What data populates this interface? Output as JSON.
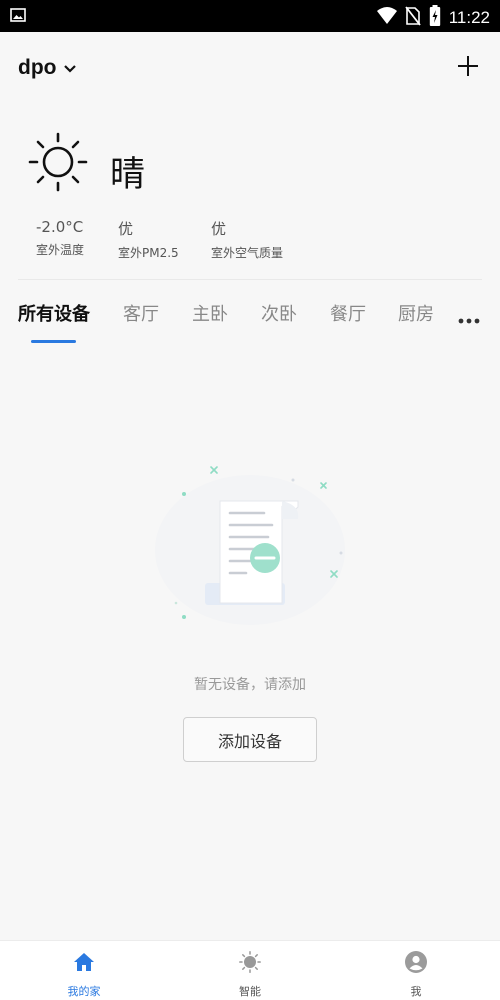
{
  "status_bar": {
    "time": "11:22",
    "icons": [
      "image-icon",
      "wifi-icon",
      "no-sim-icon",
      "battery-charging-icon"
    ]
  },
  "header": {
    "home_name": "dpo",
    "add_icon": "plus-icon"
  },
  "weather": {
    "icon": "sun-icon",
    "condition": "晴",
    "metrics": [
      {
        "value": "-2.0°C",
        "label": "室外温度"
      },
      {
        "value": "优",
        "label": "室外PM2.5"
      },
      {
        "value": "优",
        "label": "室外空气质量"
      }
    ]
  },
  "tabs": {
    "items": [
      {
        "label": "所有设备",
        "active": true
      },
      {
        "label": "客厅"
      },
      {
        "label": "主卧"
      },
      {
        "label": "次卧"
      },
      {
        "label": "餐厅"
      },
      {
        "label": "厨房"
      }
    ],
    "more_icon": "more-dots-icon",
    "accent_color": "#2a79e0"
  },
  "empty_state": {
    "illustration": "empty-document-icon",
    "message": "暂无设备，请添加",
    "button_label": "添加设备"
  },
  "bottom_nav": {
    "items": [
      {
        "label": "我的家",
        "icon": "home-icon",
        "active": true
      },
      {
        "label": "智能",
        "icon": "smart-bulb-icon"
      },
      {
        "label": "我",
        "icon": "user-icon"
      }
    ]
  }
}
